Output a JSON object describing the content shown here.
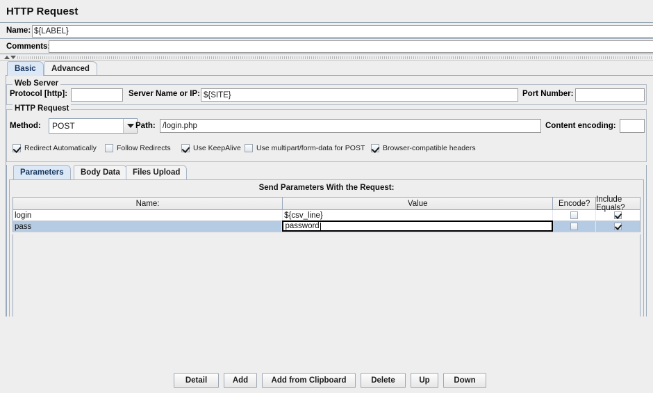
{
  "window": {
    "title": "HTTP Request"
  },
  "header": {
    "name_label": "Name:",
    "name_value": "${LABEL}",
    "comments_label": "Comments:",
    "comments_value": ""
  },
  "tabs": [
    {
      "label": "Basic",
      "selected": true
    },
    {
      "label": "Advanced",
      "selected": false
    }
  ],
  "web_server": {
    "group_label": "Web Server",
    "protocol_label": "Protocol [http]:",
    "protocol_value": "",
    "server_label": "Server Name or IP:",
    "server_value": "${SITE}",
    "port_label": "Port Number:",
    "port_value": ""
  },
  "http_request": {
    "group_label": "HTTP Request",
    "method_label": "Method:",
    "method_value": "POST",
    "path_label": "Path:",
    "path_value": "/login.php",
    "content_encoding_label": "Content encoding:",
    "content_encoding_value": "",
    "options": [
      {
        "label": "Redirect Automatically",
        "checked": true
      },
      {
        "label": "Follow Redirects",
        "checked": false
      },
      {
        "label": "Use KeepAlive",
        "checked": true
      },
      {
        "label": "Use multipart/form-data for POST",
        "checked": false
      },
      {
        "label": "Browser-compatible headers",
        "checked": true
      }
    ]
  },
  "sub_tabs": [
    {
      "label": "Parameters",
      "selected": true
    },
    {
      "label": "Body Data",
      "selected": false
    },
    {
      "label": "Files Upload",
      "selected": false
    }
  ],
  "parameters": {
    "section_title": "Send Parameters With the Request:",
    "columns": [
      "Name:",
      "Value",
      "Encode?",
      "Include Equals?"
    ],
    "rows": [
      {
        "name": "login",
        "value": "${csv_line}",
        "encode": false,
        "include_equals": true,
        "selected": false,
        "editing": false
      },
      {
        "name": "pass",
        "value": "password",
        "encode": false,
        "include_equals": true,
        "selected": true,
        "editing": true
      }
    ]
  },
  "buttons": [
    {
      "label": "Detail"
    },
    {
      "label": "Add"
    },
    {
      "label": "Add from Clipboard"
    },
    {
      "label": "Delete"
    },
    {
      "label": "Up"
    },
    {
      "label": "Down"
    }
  ]
}
